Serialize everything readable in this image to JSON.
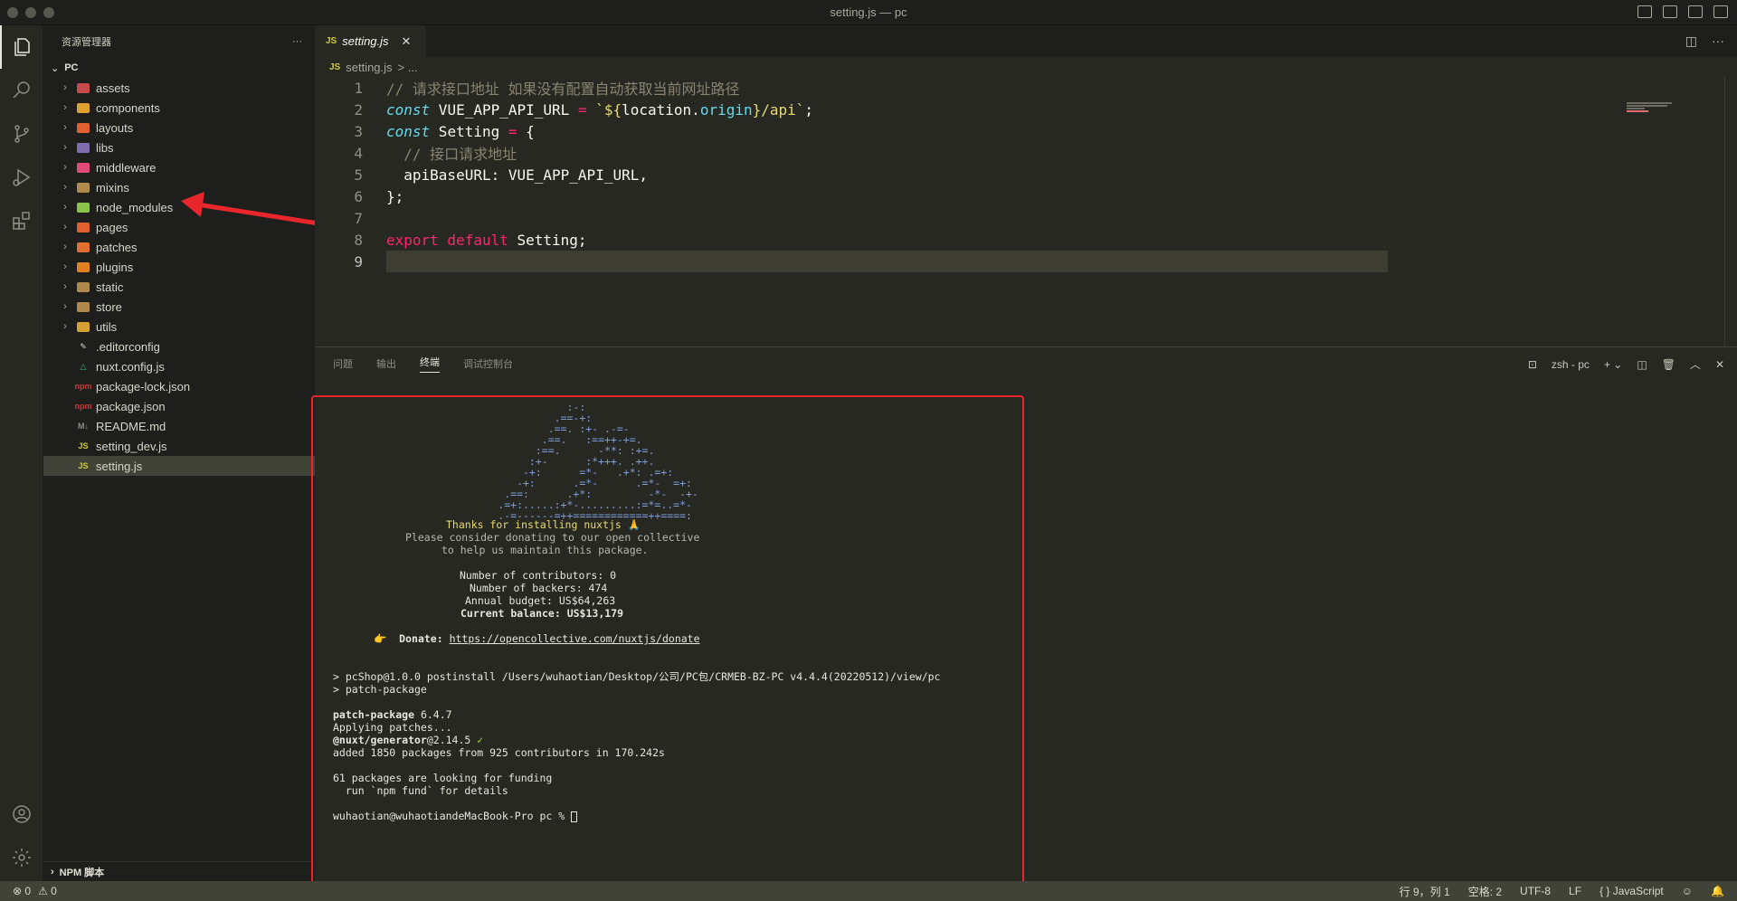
{
  "window": {
    "title": "setting.js — pc"
  },
  "sidebar": {
    "header": "资源管理器",
    "more": "···",
    "root": "PC",
    "items": [
      {
        "label": "assets",
        "type": "folder",
        "color": "#c64a4a"
      },
      {
        "label": "components",
        "type": "folder",
        "color": "#e0a030"
      },
      {
        "label": "layouts",
        "type": "folder",
        "color": "#e06030"
      },
      {
        "label": "libs",
        "type": "folder",
        "color": "#7f6fb0"
      },
      {
        "label": "middleware",
        "type": "folder",
        "color": "#e04a7a"
      },
      {
        "label": "mixins",
        "type": "folder",
        "color": "#b08a4a"
      },
      {
        "label": "node_modules",
        "type": "folder",
        "color": "#8bc34a"
      },
      {
        "label": "pages",
        "type": "folder",
        "color": "#e06030"
      },
      {
        "label": "patches",
        "type": "folder",
        "color": "#e07030"
      },
      {
        "label": "plugins",
        "type": "folder",
        "color": "#e08020"
      },
      {
        "label": "static",
        "type": "folder",
        "color": "#b08a4a"
      },
      {
        "label": "store",
        "type": "folder",
        "color": "#b08a4a"
      },
      {
        "label": "utils",
        "type": "folder",
        "color": "#d4a030"
      },
      {
        "label": ".editorconfig",
        "type": "file",
        "glyph": "✎",
        "color": "#d6d6cb"
      },
      {
        "label": "nuxt.config.js",
        "type": "file",
        "glyph": "△",
        "color": "#41b883"
      },
      {
        "label": "package-lock.json",
        "type": "file",
        "glyph": "npm",
        "color": "#cb3837"
      },
      {
        "label": "package.json",
        "type": "file",
        "glyph": "npm",
        "color": "#cb3837"
      },
      {
        "label": "README.md",
        "type": "file",
        "glyph": "M↓",
        "color": "#8d8d83"
      },
      {
        "label": "setting_dev.js",
        "type": "file",
        "glyph": "JS",
        "color": "#cbcb41"
      },
      {
        "label": "setting.js",
        "type": "file",
        "glyph": "JS",
        "color": "#cbcb41",
        "selected": true
      }
    ],
    "footer": "NPM 脚本"
  },
  "editor": {
    "tab_label": "setting.js",
    "tab_lang": "JS",
    "breadcrumb_file": "setting.js",
    "breadcrumb_rest": "> ...",
    "lines": {
      "l1": "// 请求接口地址 如果没有配置自动获取当前网址路径",
      "l2a": "const",
      "l2b": " VUE_APP_API_URL ",
      "l2c": "=",
      "l2d": " `${",
      "l2e": "location",
      "l2f": ".",
      "l2g": "origin",
      "l2h": "}/api`",
      "l2i": ";",
      "l3a": "const",
      "l3b": " Setting ",
      "l3c": "=",
      "l3d": " {",
      "l4": "  // 接口请求地址",
      "l5": "  apiBaseURL: VUE_APP_API_URL,",
      "l6": "};",
      "l8a": "export",
      "l8b": " default",
      "l8c": " Setting;"
    }
  },
  "panel": {
    "tabs": [
      "问题",
      "输出",
      "终端",
      "调试控制台"
    ],
    "active_tab": "终端",
    "shell": "zsh - pc",
    "terminal": {
      "art": [
        "                    :-:",
        "                  .==-+:",
        "                 .==. :+- .-=-",
        "                .==.   :==++-+=.",
        "               :==.      -**: :+=.",
        "              :+-      :*+++. .++.",
        "             -+:      =*-   .+*: .=+:",
        "            -+:      .=*-      .=*-  =+:",
        "          .==:      .+*:         -*-  -+-",
        "         .=+:.....:+*-.........:=*=..=*-",
        "         .-=------=++============++====:"
      ],
      "thanks": "Thanks for installing nuxtjs 🙏",
      "donate_msg1": "Please consider donating to our open collective",
      "donate_msg2": "to help us maintain this package.",
      "contributors": "Number of contributors: 0",
      "backers": "Number of backers: 474",
      "budget": "Annual budget: US$64,263",
      "balance": "Current balance: US$13,179",
      "donate_label": "Donate:",
      "donate_url": "https://opencollective.com/nuxtjs/donate",
      "post1": "> pcShop@1.0.0 postinstall /Users/wuhaotian/Desktop/公司/PC包/CRMEB-BZ-PC v4.4.4(20220512)/view/pc",
      "post2": "> patch-package",
      "pp_name": "patch-package",
      "pp_ver": " 6.4.7",
      "applying": "Applying patches...",
      "gen_name": "@nuxt/generator",
      "gen_ver": "@2.14.5 ",
      "gen_check": "✓",
      "added": "added 1850 packages from 925 contributors in 170.242s",
      "funding1": "61 packages are looking for funding",
      "funding2": "  run `npm fund` for details",
      "prompt": "wuhaotian@wuhaotiandeMacBook-Pro pc % "
    }
  },
  "statusbar": {
    "errors": "⊗ 0",
    "warnings": "⚠ 0",
    "position": "行 9，列 1",
    "spaces": "空格: 2",
    "encoding": "UTF-8",
    "eol": "LF",
    "language": "{ } JavaScript"
  },
  "colors": {
    "accent_red": "#e8262b",
    "sidebar_bg": "#1e1f1c",
    "editor_bg": "#272822"
  }
}
